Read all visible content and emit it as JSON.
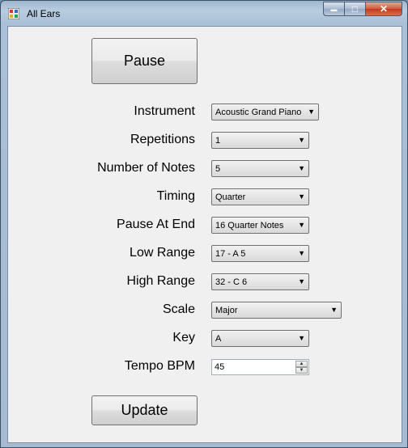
{
  "window": {
    "title": "All Ears"
  },
  "buttons": {
    "pause": "Pause",
    "update": "Update"
  },
  "caption": {
    "min": "▬",
    "max": "□",
    "close": "✕"
  },
  "fields": [
    {
      "label": "Instrument",
      "value": "Acoustic Grand Piano"
    },
    {
      "label": "Repetitions",
      "value": "1"
    },
    {
      "label": "Number of Notes",
      "value": "5"
    },
    {
      "label": "Timing",
      "value": "Quarter"
    },
    {
      "label": "Pause At End",
      "value": "16 Quarter Notes"
    },
    {
      "label": "Low Range",
      "value": "17 - A 5"
    },
    {
      "label": "High Range",
      "value": "32 - C 6"
    },
    {
      "label": "Scale",
      "value": "Major"
    },
    {
      "label": "Key",
      "value": "A"
    },
    {
      "label": "Tempo BPM",
      "value": "45"
    }
  ],
  "icons": {
    "dropdown": "▼",
    "spin_up": "▲",
    "spin_down": "▼"
  }
}
